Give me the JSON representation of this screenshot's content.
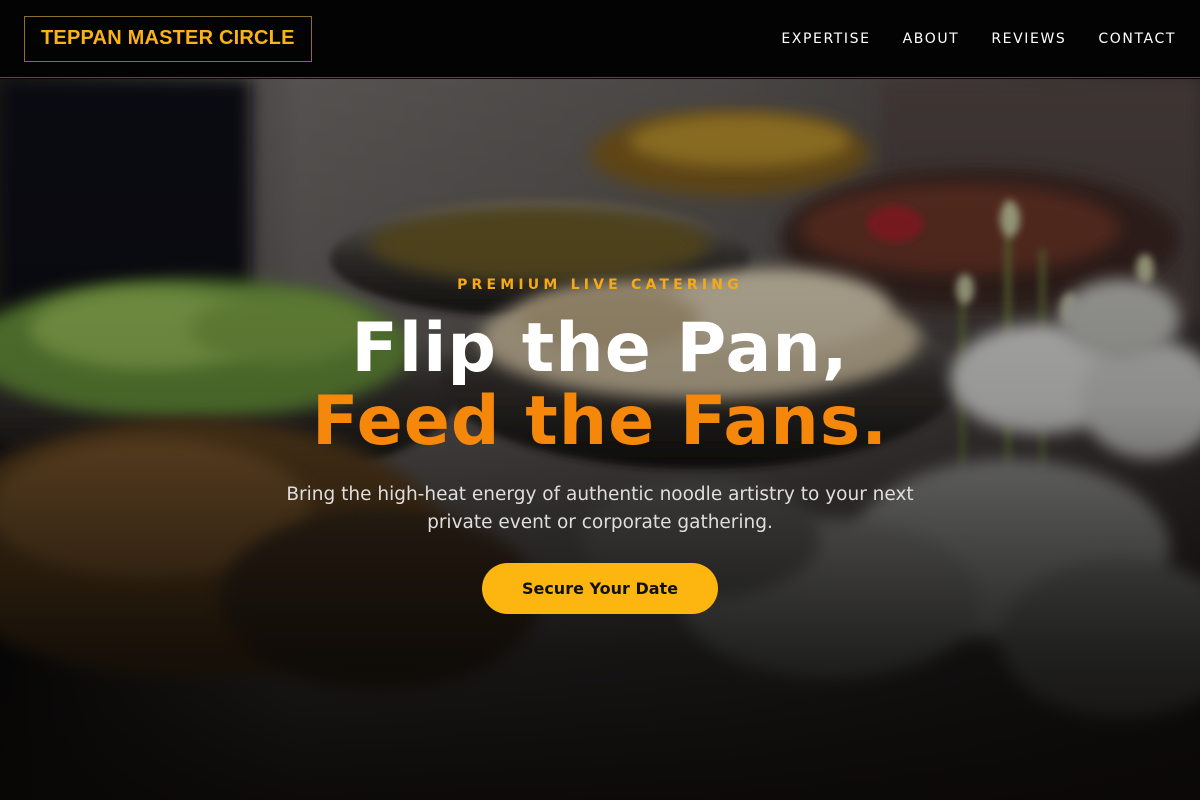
{
  "header": {
    "brand": "TEPPAN MASTER CIRCLE",
    "nav": [
      {
        "label": "EXPERTISE"
      },
      {
        "label": "ABOUT"
      },
      {
        "label": "REVIEWS"
      },
      {
        "label": "CONTACT"
      }
    ]
  },
  "hero": {
    "eyebrow": "PREMIUM LIVE CATERING",
    "headline_line1": "Flip the Pan,",
    "headline_line2": "Feed the Fans.",
    "subtext": "Bring the high-heat energy of authentic noodle artistry to your next private event or corporate gathering.",
    "cta_label": "Secure Your Date"
  },
  "colors": {
    "brand": "#fbb214",
    "accent_orange": "#f5870b",
    "cta_background": "#fdb50f",
    "header_background": "#030303"
  }
}
